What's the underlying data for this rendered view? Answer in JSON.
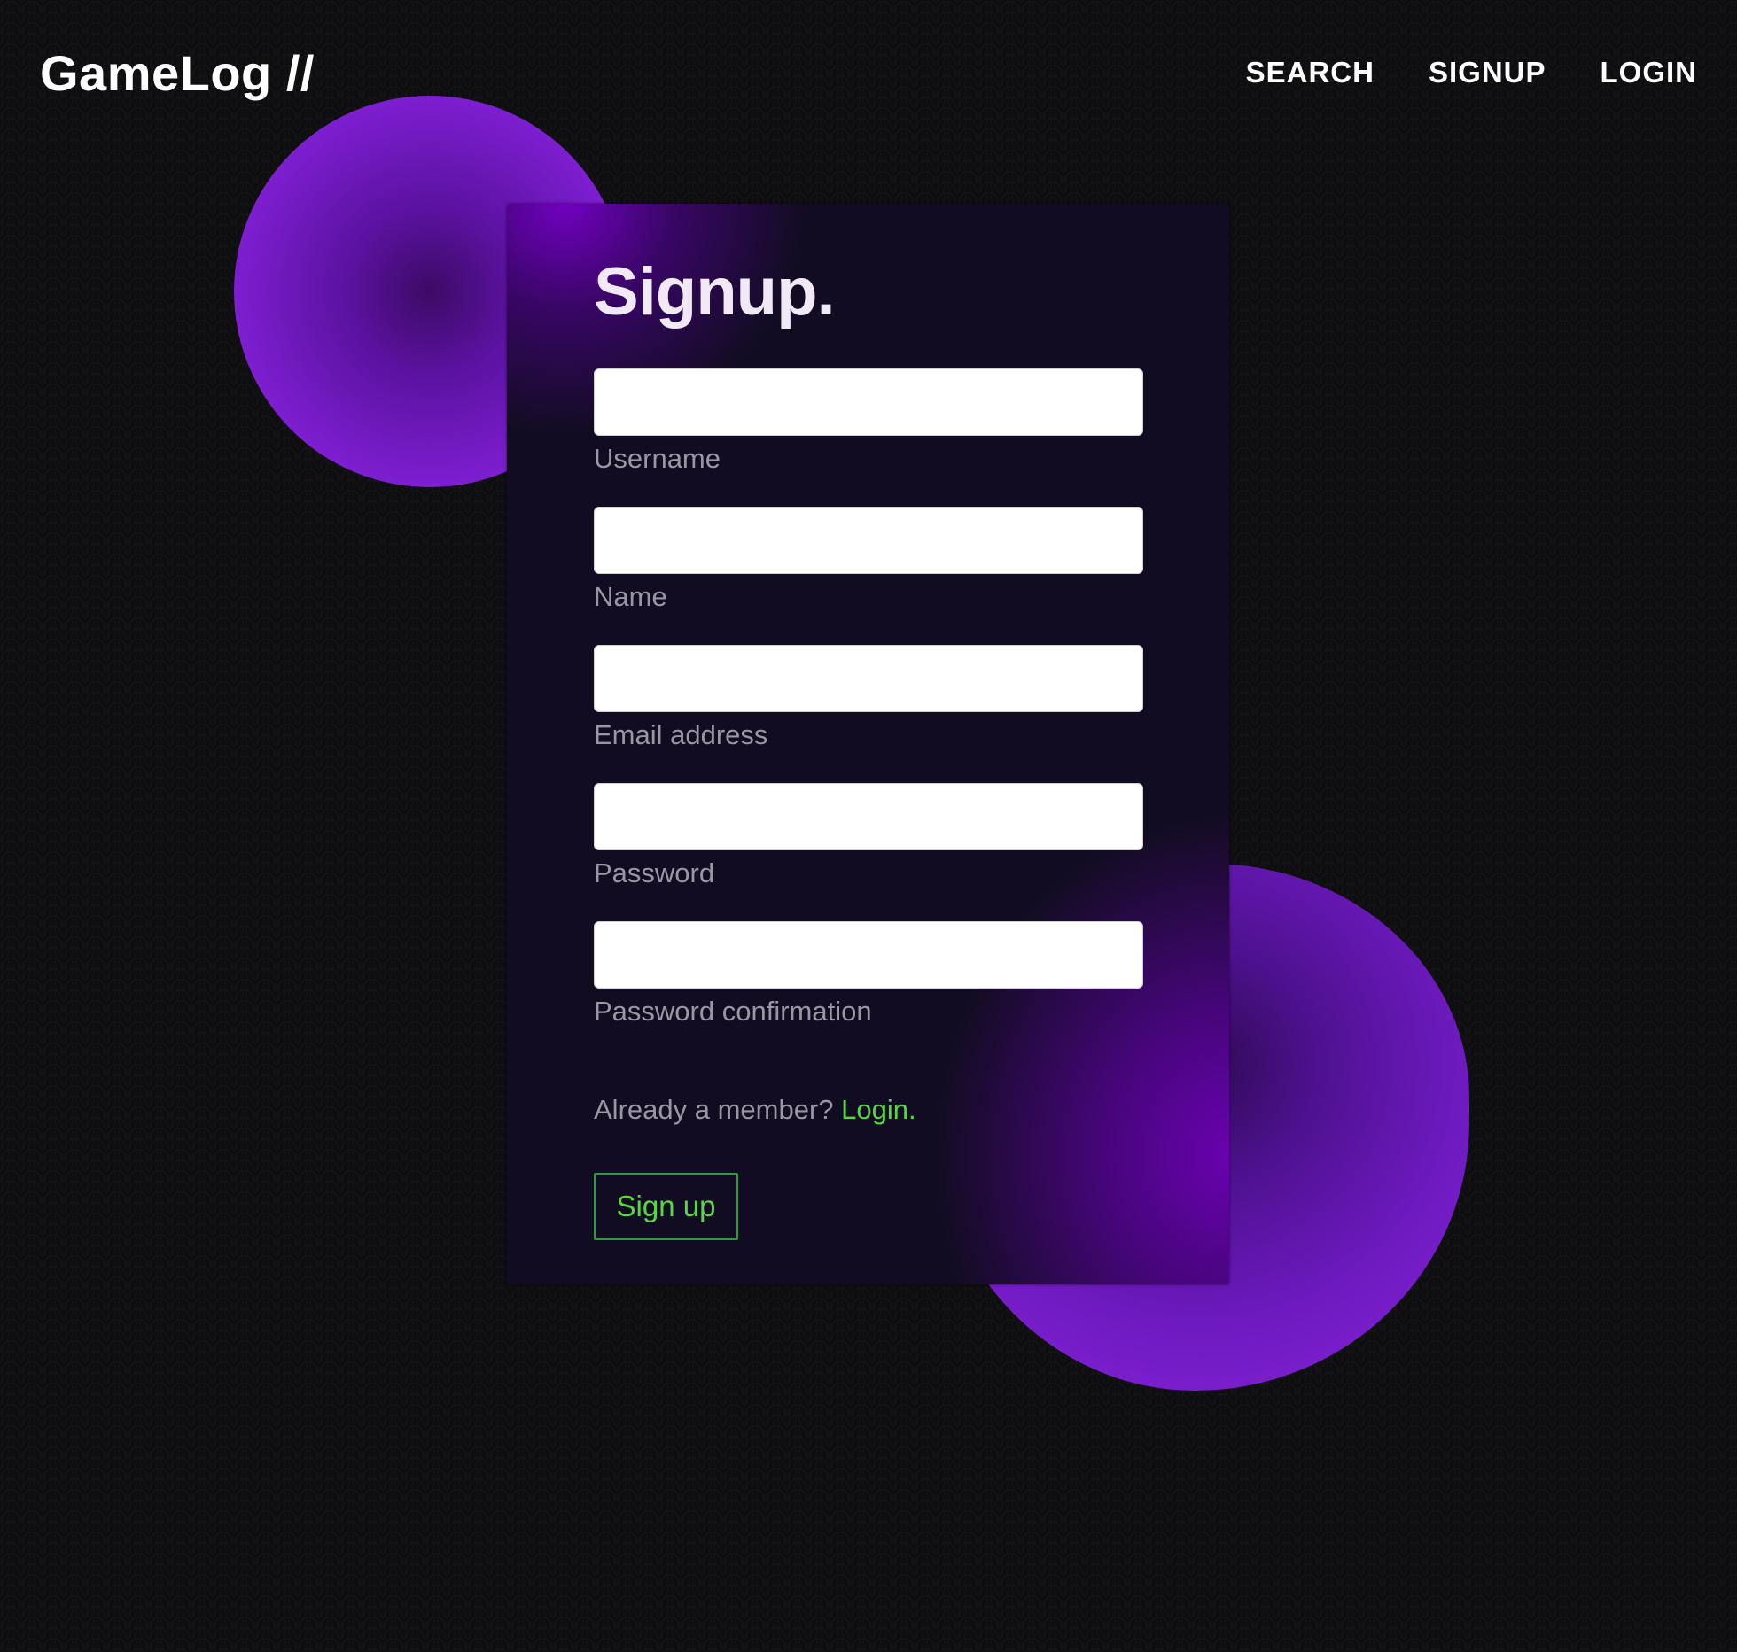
{
  "brand": "GameLog //",
  "nav": {
    "search": "SEARCH",
    "signup": "SIGNUP",
    "login": "LOGIN"
  },
  "form": {
    "title": "Signup.",
    "fields": [
      {
        "label": "Username",
        "value": "",
        "placeholder": ""
      },
      {
        "label": "Name",
        "value": "",
        "placeholder": ""
      },
      {
        "label": "Email address",
        "value": "",
        "placeholder": ""
      },
      {
        "label": "Password",
        "value": "",
        "placeholder": ""
      },
      {
        "label": "Password confirmation",
        "value": "",
        "placeholder": ""
      }
    ],
    "member_prompt": "Already a member?",
    "login_link": "Login.",
    "submit_label": "Sign up"
  },
  "colors": {
    "background": "#0e0e10",
    "accent_purple": "#7d1ed0",
    "link_green": "#58d742",
    "card": "#120c22"
  }
}
